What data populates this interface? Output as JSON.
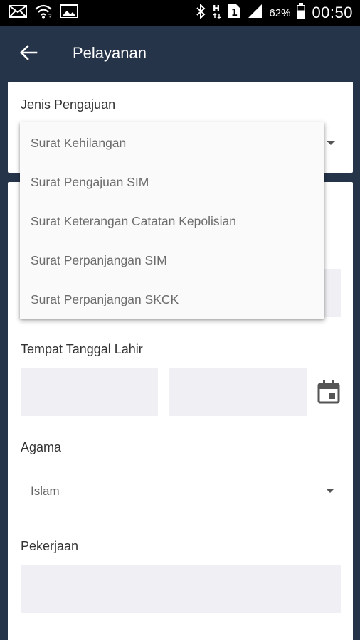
{
  "status_bar": {
    "battery": "62%",
    "time": "00:50",
    "icons": [
      "mail-icon",
      "wifi-icon",
      "image-icon",
      "bluetooth-icon",
      "signal-icon",
      "sim-icon",
      "battery-icon"
    ]
  },
  "app_bar": {
    "title": "Pelayanan",
    "back_icon": "arrow-left-icon"
  },
  "form": {
    "jenis_pengajuan_label": "Jenis Pengajuan",
    "tempat_tanggal_lahir_label": "Tempat Tanggal Lahir",
    "agama_label": "Agama",
    "agama_value": "Islam",
    "pekerjaan_label": "Pekerjaan"
  },
  "dropdown": {
    "options": [
      "Surat Kehilangan",
      "Surat Pengajuan SIM",
      "Surat Keterangan Catatan Kepolisian",
      "Surat Perpanjangan SIM",
      "Surat Perpanjangan SKCK"
    ]
  },
  "colors": {
    "header_bg": "#26344a",
    "card_bg": "#ffffff",
    "field_bg": "#f0f0f4",
    "dropdown_bg": "#fafafa"
  }
}
